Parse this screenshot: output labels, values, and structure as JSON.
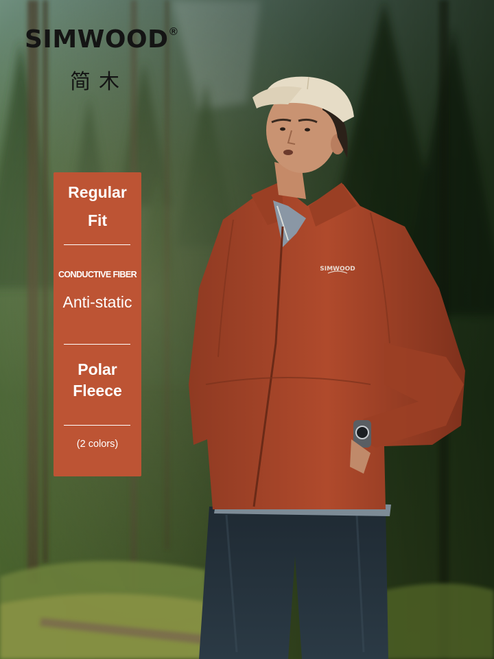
{
  "brand": {
    "name": "SIMWOOD",
    "registered_mark": "®",
    "chinese_name": "简木"
  },
  "features": {
    "fit_line1": "Regular",
    "fit_line2": "Fit",
    "fiber_label": "CONDUCTIVE FIBER",
    "antistatic_label": "Anti-static",
    "material_line1": "Polar",
    "material_line2": "Fleece",
    "colors_note": "(2 colors)"
  },
  "jacket_logo": "SIMWOOD",
  "colors": {
    "panel": "#bd5434",
    "jacket": "#a8452a",
    "brand_text": "#141414"
  }
}
